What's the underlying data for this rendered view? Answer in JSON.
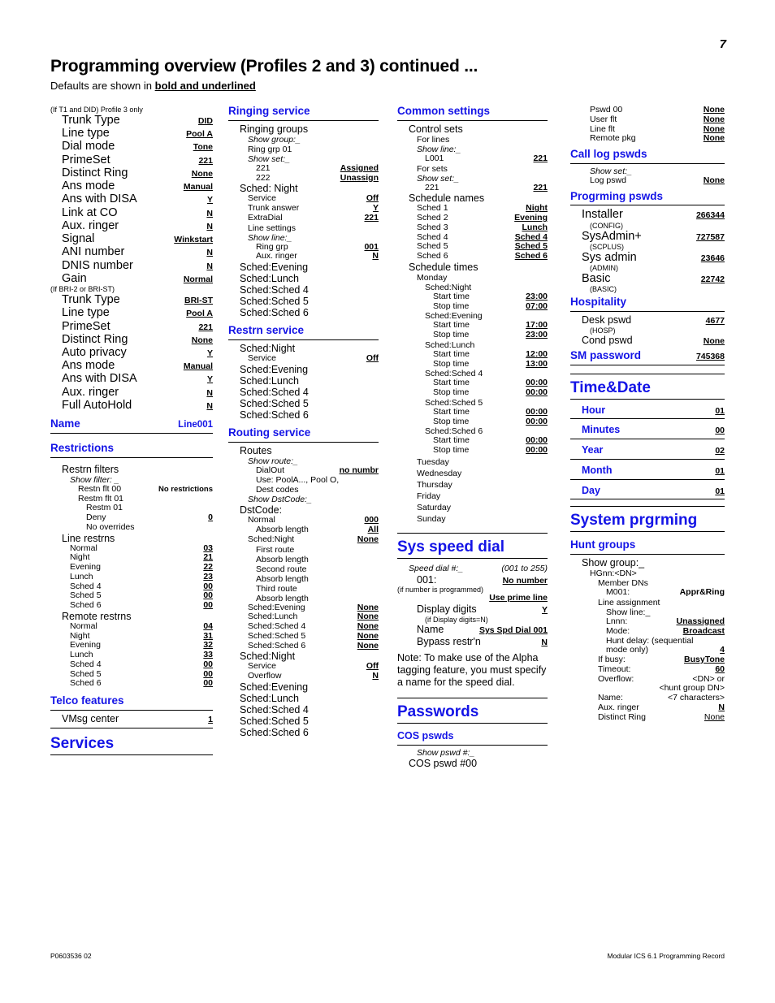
{
  "page_number": "7",
  "header": {
    "title": "Programming overview (Profiles 2 and 3) continued ...",
    "subtitle_prefix": "Defaults are shown in ",
    "subtitle_bold": "bold and underlined"
  },
  "footer": {
    "left": "P0603536   02",
    "right": "Modular ICS 6.1 Programming Record"
  },
  "col1": {
    "note_t1did": "(If T1 and DID) Profile 3 only",
    "t1_rows": [
      {
        "label": "Trunk Type",
        "value": "DID"
      },
      {
        "label": "Line type",
        "value": "Pool A"
      },
      {
        "label": "Dial mode",
        "value": "Tone"
      },
      {
        "label": "PrimeSet",
        "value": "221"
      },
      {
        "label": "Distinct Ring",
        "value": "None"
      },
      {
        "label": "Ans mode",
        "value": "Manual"
      },
      {
        "label": "Ans with DISA",
        "value": "Y"
      },
      {
        "label": "Link at CO",
        "value": "N"
      },
      {
        "label": "Aux. ringer",
        "value": "N"
      },
      {
        "label": "Signal",
        "value": "Winkstart"
      },
      {
        "label": "ANI number",
        "value": "N"
      },
      {
        "label": "DNIS number",
        "value": "N"
      },
      {
        "label": "Gain",
        "value": "Normal"
      }
    ],
    "note_bri": "(If BRI-2 or BRI-ST)",
    "bri_rows": [
      {
        "label": "Trunk Type",
        "value": "BRI-ST"
      },
      {
        "label": "Line type",
        "value": "Pool A"
      },
      {
        "label": "PrimeSet",
        "value": "221"
      },
      {
        "label": "Distinct Ring",
        "value": "None"
      },
      {
        "label": "Auto privacy",
        "value": "Y"
      },
      {
        "label": "Ans mode",
        "value": "Manual"
      },
      {
        "label": "Ans with DISA",
        "value": "Y"
      },
      {
        "label": "Aux. ringer",
        "value": "N"
      },
      {
        "label": "Full AutoHold",
        "value": "N"
      }
    ],
    "name_heading": "Name",
    "name_value": "Line001",
    "restrictions_heading": "Restrictions",
    "restrn_filters_title": "Restrn filters",
    "show_filter": "Show filter: _",
    "filter_rows": [
      {
        "label": "Restn flt 00",
        "value": "No restrictions"
      },
      {
        "label": "Restm flt 01",
        "value": ""
      },
      {
        "label": "Restm 01",
        "value": ""
      },
      {
        "label": "Deny",
        "value": "0"
      },
      {
        "label": "No overrides",
        "value": ""
      }
    ],
    "line_restrns_title": "Line restrns",
    "line_restrns": [
      {
        "label": "Normal",
        "value": "03"
      },
      {
        "label": "Night",
        "value": "21"
      },
      {
        "label": "Evening",
        "value": "22"
      },
      {
        "label": "Lunch",
        "value": "23"
      },
      {
        "label": "Sched 4",
        "value": "00"
      },
      {
        "label": "Sched 5",
        "value": "00"
      },
      {
        "label": "Sched 6",
        "value": "00"
      }
    ],
    "remote_restrns_title": "Remote restrns",
    "remote_restrns": [
      {
        "label": "Normal",
        "value": "04"
      },
      {
        "label": "Night",
        "value": "31"
      },
      {
        "label": "Evening",
        "value": "32"
      },
      {
        "label": "Lunch",
        "value": "33"
      },
      {
        "label": "Sched 4",
        "value": "00"
      },
      {
        "label": "Sched 5",
        "value": "00"
      },
      {
        "label": "Sched 6",
        "value": "00"
      }
    ],
    "telco_heading": "Telco features",
    "vmsg_label": "VMsg center",
    "vmsg_value": "1",
    "services_heading": "Services"
  },
  "col2": {
    "ringing_heading": "Ringing service",
    "ringing_groups_title": "Ringing groups",
    "show_group": "Show group:_",
    "ring_grp_01": "Ring grp 01",
    "show_set": "Show set:_",
    "set_rows": [
      {
        "label": "221",
        "value": "Assigned"
      },
      {
        "label": "222",
        "value": "Unassign"
      }
    ],
    "sched_night": "Sched: Night",
    "night_rows": [
      {
        "label": "Service",
        "value": "Off"
      },
      {
        "label": "Trunk answer",
        "value": "Y"
      },
      {
        "label": "ExtraDial",
        "value": "221"
      }
    ],
    "line_settings": "Line settings",
    "show_line": "Show line:_",
    "line_rows": [
      {
        "label": "Ring grp",
        "value": "001"
      },
      {
        "label": "Aux. ringer",
        "value": "N"
      }
    ],
    "ring_scheds": [
      "Sched:Evening",
      "Sched:Lunch",
      "Sched:Sched 4",
      "Sched:Sched 5",
      "Sched:Sched 6"
    ],
    "restrn_heading": "Restrn service",
    "restrn_sched_night": "Sched:Night",
    "restrn_service_label": "Service",
    "restrn_service_value": "Off",
    "restrn_scheds": [
      "Sched:Evening",
      "Sched:Lunch",
      "Sched:Sched 4",
      "Sched:Sched 5",
      "Sched:Sched 6"
    ],
    "routing_heading": "Routing service",
    "routes_title": "Routes",
    "show_route": "Show route:_",
    "dialout_label": "DialOut",
    "dialout_value": "no numbr",
    "use_pool": "Use: PoolA..., Pool O,",
    "dest_codes": "Dest codes",
    "show_dstcode": "Show DstCode:_",
    "dstcode_title": "DstCode:",
    "dst_normal_label": "Normal",
    "dst_normal_value": "000",
    "dst_absorb_label": "Absorb length",
    "dst_absorb_value": "All",
    "dst_sched_night_label": "Sched:Night",
    "dst_sched_night_value": "None",
    "routes_detail": [
      "First route",
      "Absorb length",
      "Second route",
      "Absorb length",
      "Third route",
      "Absorb length"
    ],
    "dst_sched_rows": [
      {
        "label": "Sched:Evening",
        "value": "None"
      },
      {
        "label": "Sched:Lunch",
        "value": "None"
      },
      {
        "label": "Sched:Sched 4",
        "value": "None"
      },
      {
        "label": "Sched:Sched 5",
        "value": "None"
      },
      {
        "label": "Sched:Sched 6",
        "value": "None"
      }
    ],
    "ovf_sched_night": "Sched:Night",
    "ovf_rows": [
      {
        "label": "Service",
        "value": "Off"
      },
      {
        "label": "Overflow",
        "value": "N"
      }
    ],
    "ovf_scheds": [
      "Sched:Evening",
      "Sched:Lunch",
      "Sched:Sched 4",
      "Sched:Sched 5",
      "Sched:Sched 6"
    ]
  },
  "col3": {
    "common_heading": "Common settings",
    "control_sets_title": "Control sets",
    "for_lines": "For lines",
    "show_line": "Show line:_",
    "l001_label": "L001",
    "l001_value": "221",
    "for_sets": "For sets",
    "show_set": "Show set:_",
    "set221_label": "221",
    "set221_value": "221",
    "schedule_names_title": "Schedule names",
    "schedule_names": [
      {
        "label": "Sched 1",
        "value": "Night"
      },
      {
        "label": "Sched 2",
        "value": "Evening"
      },
      {
        "label": "Sched 3",
        "value": "Lunch"
      },
      {
        "label": "Sched 4",
        "value": "Sched 4"
      },
      {
        "label": "Sched 5",
        "value": "Sched 5"
      },
      {
        "label": "Sched 6",
        "value": "Sched 6"
      }
    ],
    "schedule_times_title": "Schedule times",
    "monday": "Monday",
    "monday_scheds": [
      {
        "name": "Sched:Night",
        "start": "23:00",
        "stop": "07:00"
      },
      {
        "name": "Sched:Evening",
        "start": "17:00",
        "stop": "23:00"
      },
      {
        "name": "Sched:Lunch",
        "start": "12:00",
        "stop": "13:00"
      },
      {
        "name": "Sched:Sched 4",
        "start": "00:00",
        "stop": "00:00"
      },
      {
        "name": "Sched:Sched 5",
        "start": "00:00",
        "stop": "00:00"
      },
      {
        "name": "Sched:Sched 6",
        "start": "00:00",
        "stop": "00:00"
      }
    ],
    "start_label": "Start time",
    "stop_label": "Stop time",
    "other_days": [
      "Tuesday",
      "Wednesday",
      "Thursday",
      "Friday",
      "Saturday",
      "Sunday"
    ],
    "sysspeed_heading": "Sys speed dial",
    "speed_dial_label": "Speed dial #:_",
    "speed_dial_range": "(001 to 255)",
    "speed_001_label": "001:",
    "speed_001_value": "No number",
    "if_programmed": "(if number is programmed)",
    "use_prime_line": "Use prime line",
    "display_digits_label": "Display digits",
    "display_digits_value": "Y",
    "if_display_n": "(if Display digits=N)",
    "name_label": "Name",
    "name_value": "Sys Spd Dial 001",
    "bypass_label": "Bypass restr'n",
    "bypass_value": "N",
    "note": "Note: To make use of the Alpha tagging feature, you must specify a name for the speed dial.",
    "passwords_heading": "Passwords",
    "cos_heading": "COS pswds",
    "show_pswd": "Show pswd #:_",
    "cos_pswd_00": "COS pswd #00"
  },
  "col4": {
    "pswd_rows": [
      {
        "label": "Pswd 00",
        "value": "None"
      },
      {
        "label": "User flt",
        "value": "None"
      },
      {
        "label": "Line flt",
        "value": "None"
      },
      {
        "label": "Remote pkg",
        "value": "None"
      }
    ],
    "calllog_heading": "Call log pswds",
    "show_set": "Show set:_",
    "log_pswd_label": "Log pswd",
    "log_pswd_value": "None",
    "progrming_heading": "Progrming pswds",
    "prog_rows": [
      {
        "label": "Installer",
        "value": "266344",
        "sub": "(CONFIG)"
      },
      {
        "label": "SysAdmin+",
        "value": "727587",
        "sub": "(SCPLUS)"
      },
      {
        "label": "Sys admin",
        "value": "23646",
        "sub": "(ADMIN)"
      },
      {
        "label": "Basic",
        "value": "22742",
        "sub": "(BASIC)"
      }
    ],
    "hospitality_heading": "Hospitality",
    "desk_pswd_label": "Desk pswd",
    "desk_pswd_value": "4677",
    "hosp_sub": "(HOSP)",
    "cond_pswd_label": "Cond pswd",
    "cond_pswd_value": "None",
    "sm_password_label": "SM password",
    "sm_password_value": "745368",
    "timedate_heading": "Time&Date",
    "timedate_rows": [
      {
        "label": "Hour",
        "value": "01"
      },
      {
        "label": "Minutes",
        "value": "00"
      },
      {
        "label": "Year",
        "value": "02"
      },
      {
        "label": "Month",
        "value": "01"
      },
      {
        "label": "Day",
        "value": "01"
      }
    ],
    "sysprg_heading": "System prgrming",
    "hunt_heading": "Hunt groups",
    "show_group": "Show group:_",
    "hgnn": "HGnn:<DN>",
    "member_dns": "Member DNs",
    "m001_label": "M001:",
    "m001_value": "Appr&Ring",
    "line_assignment": "Line assignment",
    "show_line": "Show line:_",
    "lnnn_label": "Lnnn:",
    "lnnn_value": "Unassigned",
    "mode_label": "Mode:",
    "mode_value": "Broadcast",
    "hunt_delay_label": "Hunt delay: (sequential",
    "hunt_delay_label2": "mode only)",
    "hunt_delay_value": "4",
    "if_busy_label": "If busy:",
    "if_busy_value": "BusyTone",
    "timeout_label": "Timeout:",
    "timeout_value": "60",
    "overflow_label": "Overflow:",
    "overflow_value": "<DN> or",
    "overflow_value2": "<hunt group DN>",
    "hg_name_label": "Name:",
    "hg_name_value": "<7 characters>",
    "hg_aux_label": "Aux. ringer",
    "hg_aux_value": "N",
    "hg_distinct_label": "Distinct Ring",
    "hg_distinct_value": "None"
  }
}
